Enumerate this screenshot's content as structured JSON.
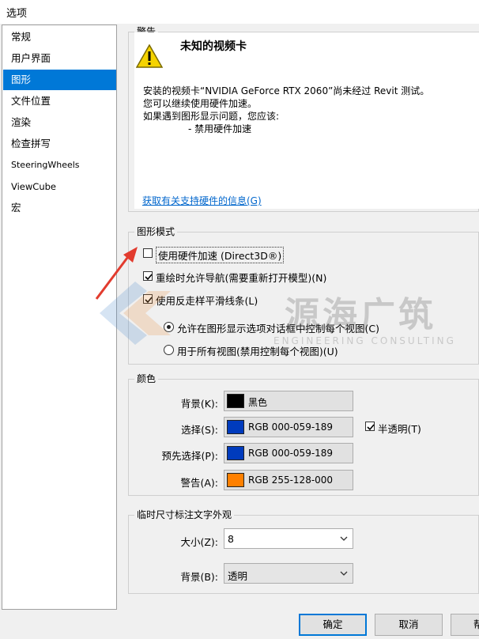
{
  "window": {
    "title": "选项"
  },
  "sidebar": {
    "items": [
      {
        "label": "常规"
      },
      {
        "label": "用户界面"
      },
      {
        "label": "图形"
      },
      {
        "label": "文件位置"
      },
      {
        "label": "渲染"
      },
      {
        "label": "检查拼写"
      },
      {
        "label": "SteeringWheels"
      },
      {
        "label": "ViewCube"
      },
      {
        "label": "宏"
      }
    ],
    "selected": "图形"
  },
  "warning": {
    "group_title": "警告",
    "heading": "未知的视频卡",
    "lines": [
      "安装的视频卡“NVIDIA GeForce RTX 2060”尚未经过 Revit 测试。",
      "您可以继续使用硬件加速。",
      "如果遇到图形显示问题，您应该:",
      "- 禁用硬件加速"
    ],
    "link": "获取有关支持硬件的信息(G)"
  },
  "graphics_mode": {
    "group_title": "图形模式",
    "hardware_accel": {
      "label": "使用硬件加速 (Direct3D®)",
      "checked": false
    },
    "redraw_nav": {
      "label": "重绘时允许导航(需要重新打开模型)(N)",
      "checked": true
    },
    "antialias": {
      "label": "使用反走样平滑线条(L)",
      "checked": true
    },
    "radio_allow": {
      "label": "允许在图形显示选项对话框中控制每个视图(C)",
      "selected": true
    },
    "radio_all": {
      "label": "用于所有视图(禁用控制每个视图)(U)",
      "selected": false
    }
  },
  "colors": {
    "group_title": "颜色",
    "background": {
      "label": "背景(K):",
      "value": "黑色",
      "swatch": "#000000"
    },
    "selection": {
      "label": "选择(S):",
      "value": "RGB 000-059-189",
      "swatch": "#003bbd"
    },
    "preselection": {
      "label": "预先选择(P):",
      "value": "RGB 000-059-189",
      "swatch": "#003bbd"
    },
    "alert": {
      "label": "警告(A):",
      "value": "RGB 255-128-000",
      "swatch": "#ff8000"
    },
    "semi_transparent": {
      "label": "半透明(T)",
      "checked": true
    }
  },
  "temp_dim": {
    "group_title": "临时尺寸标注文字外观",
    "size": {
      "label": "大小(Z):",
      "value": "8"
    },
    "background": {
      "label": "背景(B):",
      "value": "透明"
    }
  },
  "buttons": {
    "ok": "确定",
    "cancel": "取消",
    "partial": "帮"
  },
  "watermark": {
    "cn": "源海广筑",
    "en": "ENGINEERING CONSULTING"
  }
}
